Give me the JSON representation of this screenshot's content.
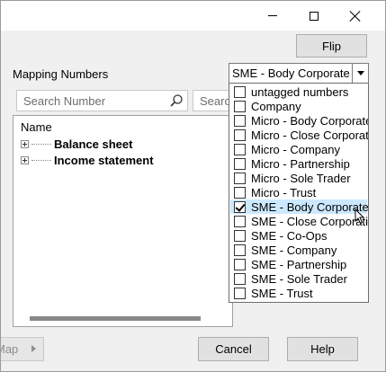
{
  "dialog": {
    "flip_label": "Flip",
    "mapping_label": "Mapping Numbers",
    "selected_mapping": "SME - Body Corporate",
    "search_placeholder": "Search Number",
    "search2_placeholder": "Search Name",
    "tree_header": "Name",
    "tree_items": [
      "Balance sheet",
      "Income statement"
    ],
    "cancel_label": "Cancel",
    "help_label": "Help",
    "left_nav_label": "Map"
  },
  "dropdown": {
    "options": [
      {
        "label": "untagged numbers",
        "checked": false
      },
      {
        "label": "Company",
        "checked": false
      },
      {
        "label": "Micro - Body Corporate",
        "checked": false
      },
      {
        "label": "Micro - Close Corporation",
        "checked": false
      },
      {
        "label": "Micro - Company",
        "checked": false
      },
      {
        "label": "Micro - Partnership",
        "checked": false
      },
      {
        "label": "Micro - Sole Trader",
        "checked": false
      },
      {
        "label": "Micro - Trust",
        "checked": false
      },
      {
        "label": "SME - Body Corporate",
        "checked": true
      },
      {
        "label": "SME - Close Corporation",
        "checked": false
      },
      {
        "label": "SME - Co-Ops",
        "checked": false
      },
      {
        "label": "SME - Company",
        "checked": false
      },
      {
        "label": "SME - Partnership",
        "checked": false
      },
      {
        "label": "SME - Sole Trader",
        "checked": false
      },
      {
        "label": "SME - Trust",
        "checked": false
      }
    ]
  },
  "icons": {
    "minimize": "minimize-icon",
    "maximize": "maximize-icon",
    "close": "close-icon",
    "search": "search-icon",
    "dropdown": "chevron-down-icon"
  },
  "colors": {
    "highlight": "#cce8ff"
  }
}
